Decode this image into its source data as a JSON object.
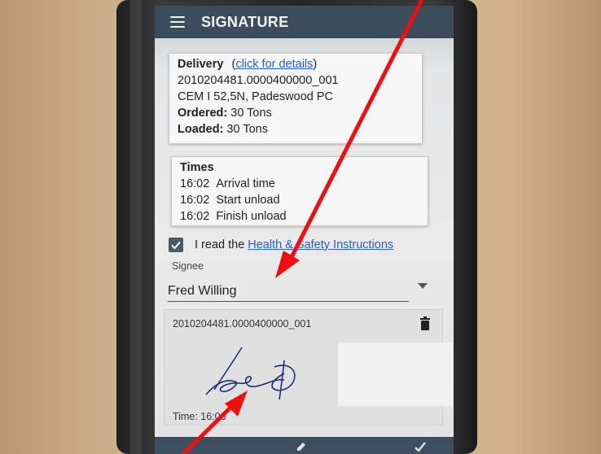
{
  "app": {
    "title": "SIGNATURE"
  },
  "delivery": {
    "heading": "Delivery",
    "details_link": "click for details",
    "paren_open": "(",
    "paren_close": ")",
    "number": "2010204481.0000400000_001",
    "product": "CEM I 52,5N, Padeswood PC",
    "ordered_label": "Ordered:",
    "ordered_value": "30 Tons",
    "loaded_label": "Loaded:",
    "loaded_value": "30 Tons"
  },
  "times": {
    "heading": "Times",
    "rows": [
      {
        "time": "16:02",
        "label": "Arrival time"
      },
      {
        "time": "16:02",
        "label": "Start unload"
      },
      {
        "time": "16:02",
        "label": "Finish unload"
      }
    ]
  },
  "health_safety": {
    "checked": true,
    "text": "I read the",
    "link": "Health & Safety Instructions"
  },
  "signee": {
    "label": "Signee",
    "value": "Fred Willing"
  },
  "signature": {
    "id": "2010204481.0000400000_001",
    "time_label": "Time:",
    "time_value": "16:06"
  },
  "colors": {
    "app_bar": "#3d4c5b",
    "link": "#2a5bd7",
    "annotation_arrow": "#ee1010",
    "signature_ink": "#1d2d7a"
  },
  "icons": {
    "menu": "hamburger-icon",
    "check": "checkbox-checked-icon",
    "dropdown": "chevron-down-icon",
    "delete": "trash-icon",
    "edit": "edit-icon",
    "confirm": "checkmark-icon"
  }
}
